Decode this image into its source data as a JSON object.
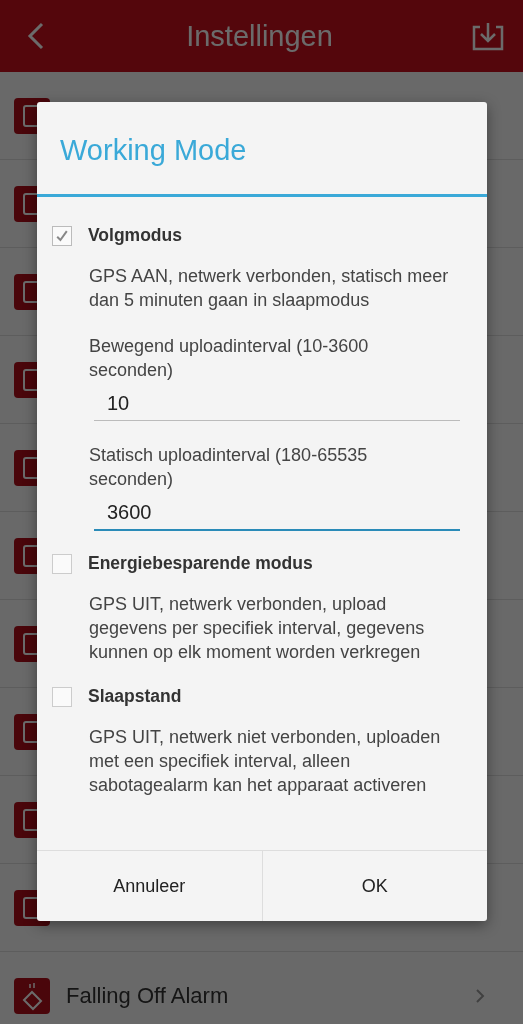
{
  "app_bar": {
    "title": "Instellingen"
  },
  "background_row": {
    "label": "Falling Off Alarm"
  },
  "dialog": {
    "title": "Working Mode",
    "modes": [
      {
        "label": "Volgmodus",
        "checked": true,
        "description": "GPS AAN, netwerk verbonden, statisch meer dan 5 minuten gaan in slaapmodus",
        "fields": [
          {
            "label": "Bewegend uploadinterval (10-3600 seconden)",
            "value": "10",
            "focused": false
          },
          {
            "label": "Statisch uploadinterval (180-65535 seconden)",
            "value": "3600",
            "focused": true
          }
        ]
      },
      {
        "label": "Energiebesparende modus",
        "checked": false,
        "description": "GPS UIT, netwerk verbonden, upload gegevens per specifiek interval, gegevens kunnen op elk moment worden verkregen"
      },
      {
        "label": "Slaapstand",
        "checked": false,
        "description": "GPS UIT, netwerk niet verbonden, uploaden met een specifiek interval, alleen sabotagealarm kan het apparaat activeren"
      }
    ],
    "buttons": [
      "Annuleer",
      "OK"
    ]
  }
}
